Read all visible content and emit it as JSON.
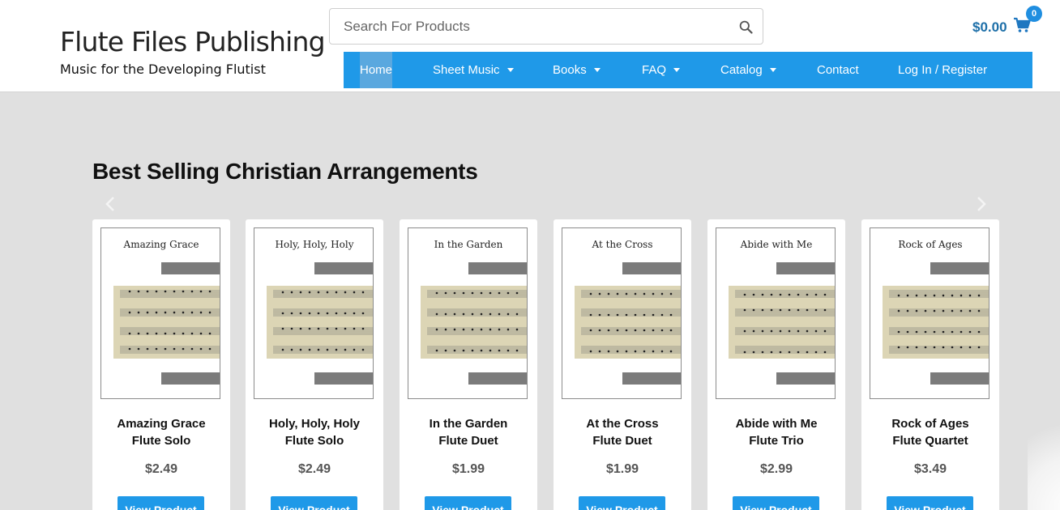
{
  "brand": {
    "title": "Flute Files Publishing",
    "tagline": "Music for the Developing Flutist"
  },
  "search": {
    "placeholder": "Search For Products",
    "icon": "search-icon"
  },
  "cart": {
    "total": "$0.00",
    "count": "0",
    "icon": "shopping-cart-icon"
  },
  "nav": {
    "items": [
      {
        "label": "Home",
        "dropdown": false,
        "active": true
      },
      {
        "label": "Sheet Music",
        "dropdown": true
      },
      {
        "label": "Books",
        "dropdown": true
      },
      {
        "label": "FAQ",
        "dropdown": true
      },
      {
        "label": "Catalog",
        "dropdown": true
      },
      {
        "label": "Contact",
        "dropdown": false
      },
      {
        "label": "Log In / Register",
        "dropdown": false
      }
    ]
  },
  "section": {
    "title": "Best Selling Christian Arrangements"
  },
  "products": [
    {
      "cover_title": "Amazing Grace",
      "line1": "Amazing Grace",
      "line2": "Flute Solo",
      "price": "$2.49",
      "button": "View Product"
    },
    {
      "cover_title": "Holy, Holy, Holy",
      "line1": "Holy, Holy, Holy",
      "line2": "Flute Solo",
      "price": "$2.49",
      "button": "View Product"
    },
    {
      "cover_title": "In the Garden",
      "line1": "In the Garden",
      "line2": "Flute Duet",
      "price": "$1.99",
      "button": "View Product"
    },
    {
      "cover_title": "At the Cross",
      "line1": "At the Cross",
      "line2": "Flute Duet",
      "price": "$1.99",
      "button": "View Product"
    },
    {
      "cover_title": "Abide with Me",
      "line1": "Abide with Me",
      "line2": "Flute Trio",
      "price": "$2.99",
      "button": "View Product"
    },
    {
      "cover_title": "Rock of Ages",
      "line1": "Rock of Ages",
      "line2": "Flute Quartet",
      "price": "$3.49",
      "button": "View Product"
    }
  ],
  "colors": {
    "accent": "#1f99e8",
    "nav_active": "#5aa8df",
    "cart_text": "#1d6fa8",
    "background": "#e0e0e0"
  }
}
